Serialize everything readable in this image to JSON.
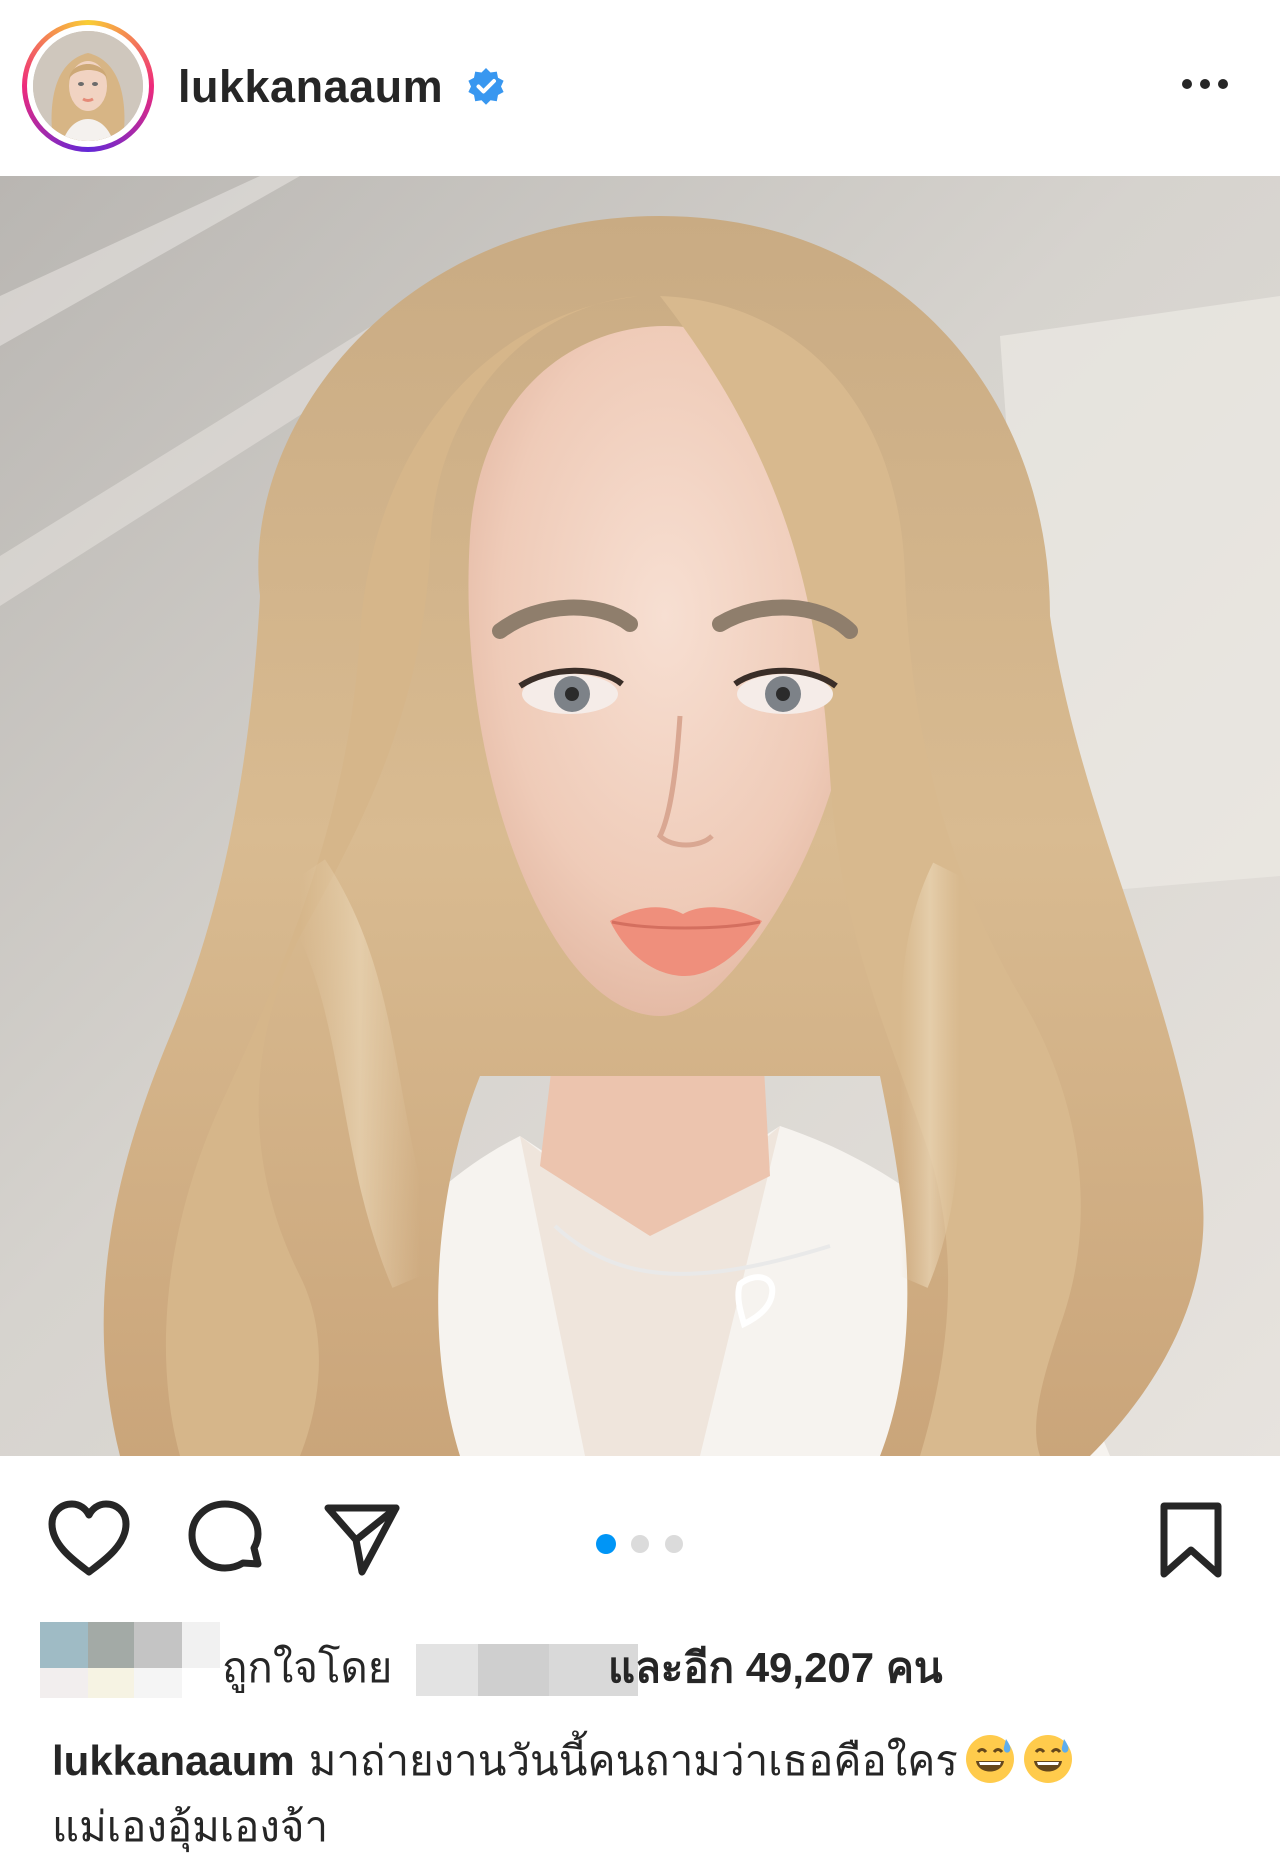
{
  "post": {
    "username": "lukkanaaum",
    "verified": true,
    "more_icon": "more-horizontal-icon",
    "carousel": {
      "count": 3,
      "active_index": 0,
      "active_color": "#0095f6",
      "inactive_color": "#dbdbdb"
    }
  },
  "actions": {
    "like_icon": "heart-icon",
    "comment_icon": "comment-icon",
    "share_icon": "share-icon",
    "save_icon": "bookmark-icon"
  },
  "likes": {
    "prefix": "ถูกใจโดย",
    "suffix": "และอีก 49,207 คน"
  },
  "caption": {
    "username": "lukkanaaum",
    "line1": "มาถ่ายงานวันนี้คนถามว่าเธอคือใคร",
    "line2": "แม่เองอุ้มเองจ้า",
    "emoji_icon": "grinning-sweat-emoji-icon"
  },
  "colors": {
    "text": "#262626",
    "verified_blue": "#3897f0",
    "accent_blue": "#0095f6"
  }
}
